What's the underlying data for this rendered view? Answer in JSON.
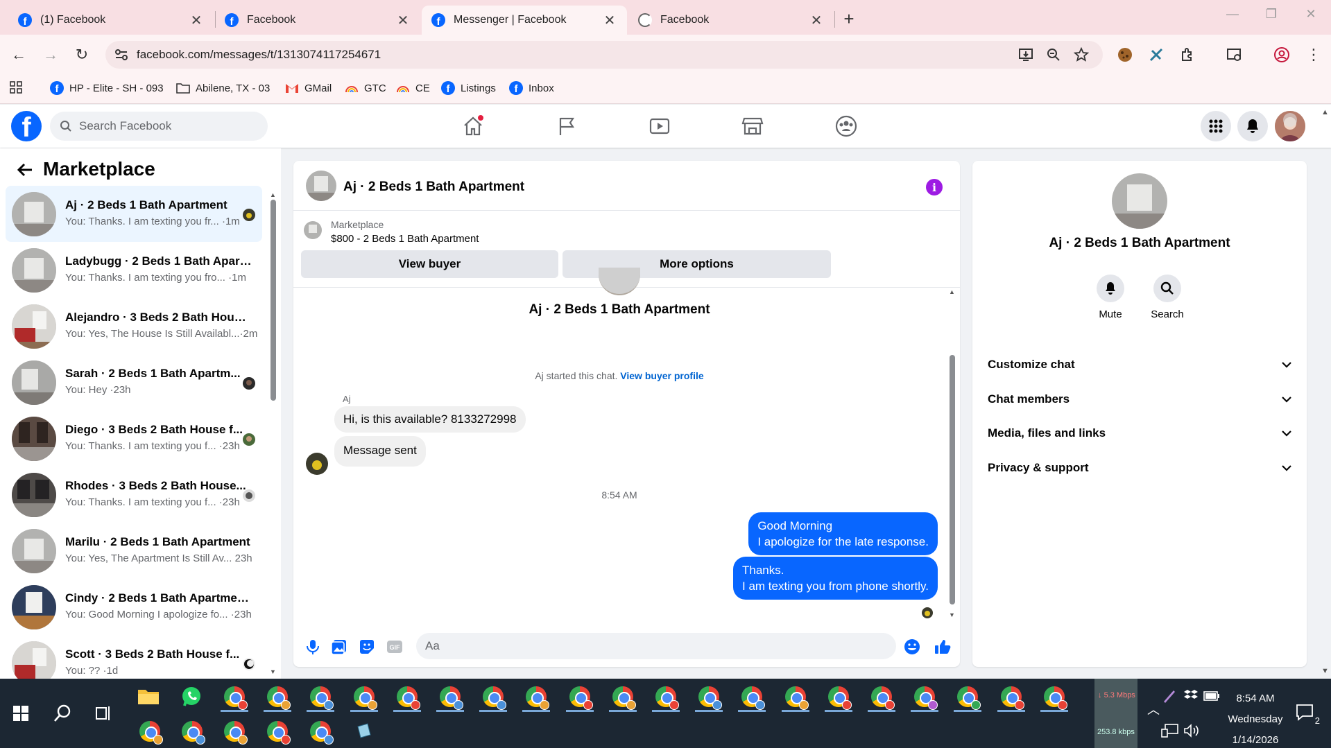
{
  "browser": {
    "tabs": [
      {
        "title": "(1) Facebook",
        "icon": "facebook-icon"
      },
      {
        "title": "Facebook",
        "icon": "facebook-icon"
      },
      {
        "title": "Messenger | Facebook",
        "icon": "facebook-icon"
      },
      {
        "title": "Facebook",
        "icon": "loading-icon"
      }
    ],
    "url": "facebook.com/messages/t/1313074117254671",
    "bookmarks": [
      {
        "label": "HP - Elite - SH - 093",
        "icon": "facebook-icon"
      },
      {
        "label": "Abilene, TX - 03",
        "icon": "folder-icon"
      },
      {
        "label": "GMail",
        "icon": "gmail-icon"
      },
      {
        "label": "GTC",
        "icon": "rainbow-icon"
      },
      {
        "label": "CE",
        "icon": "rainbow-icon"
      },
      {
        "label": "Listings",
        "icon": "facebook-icon"
      },
      {
        "label": "Inbox",
        "icon": "facebook-icon"
      }
    ]
  },
  "facebook": {
    "search_placeholder": "Search Facebook",
    "brand_color": "#0866ff"
  },
  "marketplace": {
    "title": "Marketplace",
    "chats": [
      {
        "name": "Aj · 2 Beds 1 Bath Apartment",
        "preview": "You: Thanks. I am texting you fr... ·1m",
        "selected": true
      },
      {
        "name": "Ladybugg · 2 Beds 1 Bath Apart...",
        "preview": "You: Thanks. I am texting you fro... ·1m"
      },
      {
        "name": "Alejandro · 3 Beds 2 Bath House...",
        "preview": "You: Yes, The House Is Still Availabl...·2m"
      },
      {
        "name": "Sarah · 2 Beds 1 Bath Apartm...",
        "preview": "You: Hey ·23h"
      },
      {
        "name": "Diego · 3 Beds 2 Bath House f...",
        "preview": "You: Thanks. I am texting you f... ·23h"
      },
      {
        "name": "Rhodes · 3 Beds 2 Bath House...",
        "preview": "You: Thanks. I am texting you f... ·23h"
      },
      {
        "name": "Marilu · 2 Beds 1 Bath Apartment",
        "preview": "You: Yes, The Apartment Is Still Av... 23h"
      },
      {
        "name": "Cindy · 2 Beds 1 Bath Apartment...",
        "preview": "You: Good Morning I apologize fo... ·23h"
      },
      {
        "name": "Scott · 3 Beds 2 Bath House f...",
        "preview": "You: ?? ·1d"
      }
    ]
  },
  "conversation": {
    "title": "Aj · 2 Beds 1 Bath Apartment",
    "listing_label": "Marketplace",
    "listing_price": "$800 - 2 Beds 1 Bath Apartment",
    "view_buyer": "View buyer",
    "more_options": "More options",
    "chat_name": "Aj · 2 Beds 1 Bath Apartment",
    "started_text": "Aj started this chat.",
    "view_buyer_profile": "View buyer profile",
    "sender": "Aj",
    "incoming": [
      "Hi, is this available? 8133272998",
      "Message sent"
    ],
    "timestamp": "8:54 AM",
    "outgoing": [
      {
        "line1": "Good Morning",
        "line2": "I apologize for the late response."
      },
      {
        "line1": "Thanks.",
        "line2": "I am texting you from phone shortly."
      }
    ],
    "composer_placeholder": "Aa"
  },
  "details": {
    "name": "Aj · 2 Beds 1 Bath Apartment",
    "mute": "Mute",
    "search": "Search",
    "sections": [
      "Customize chat",
      "Chat members",
      "Media, files and links",
      "Privacy & support"
    ]
  },
  "taskbar": {
    "net_up": "5.3 Mbps",
    "net_down": "253.8 kbps",
    "time": "8:54 AM",
    "day": "Wednesday",
    "date": "1/14/2026",
    "notifications": "2"
  }
}
